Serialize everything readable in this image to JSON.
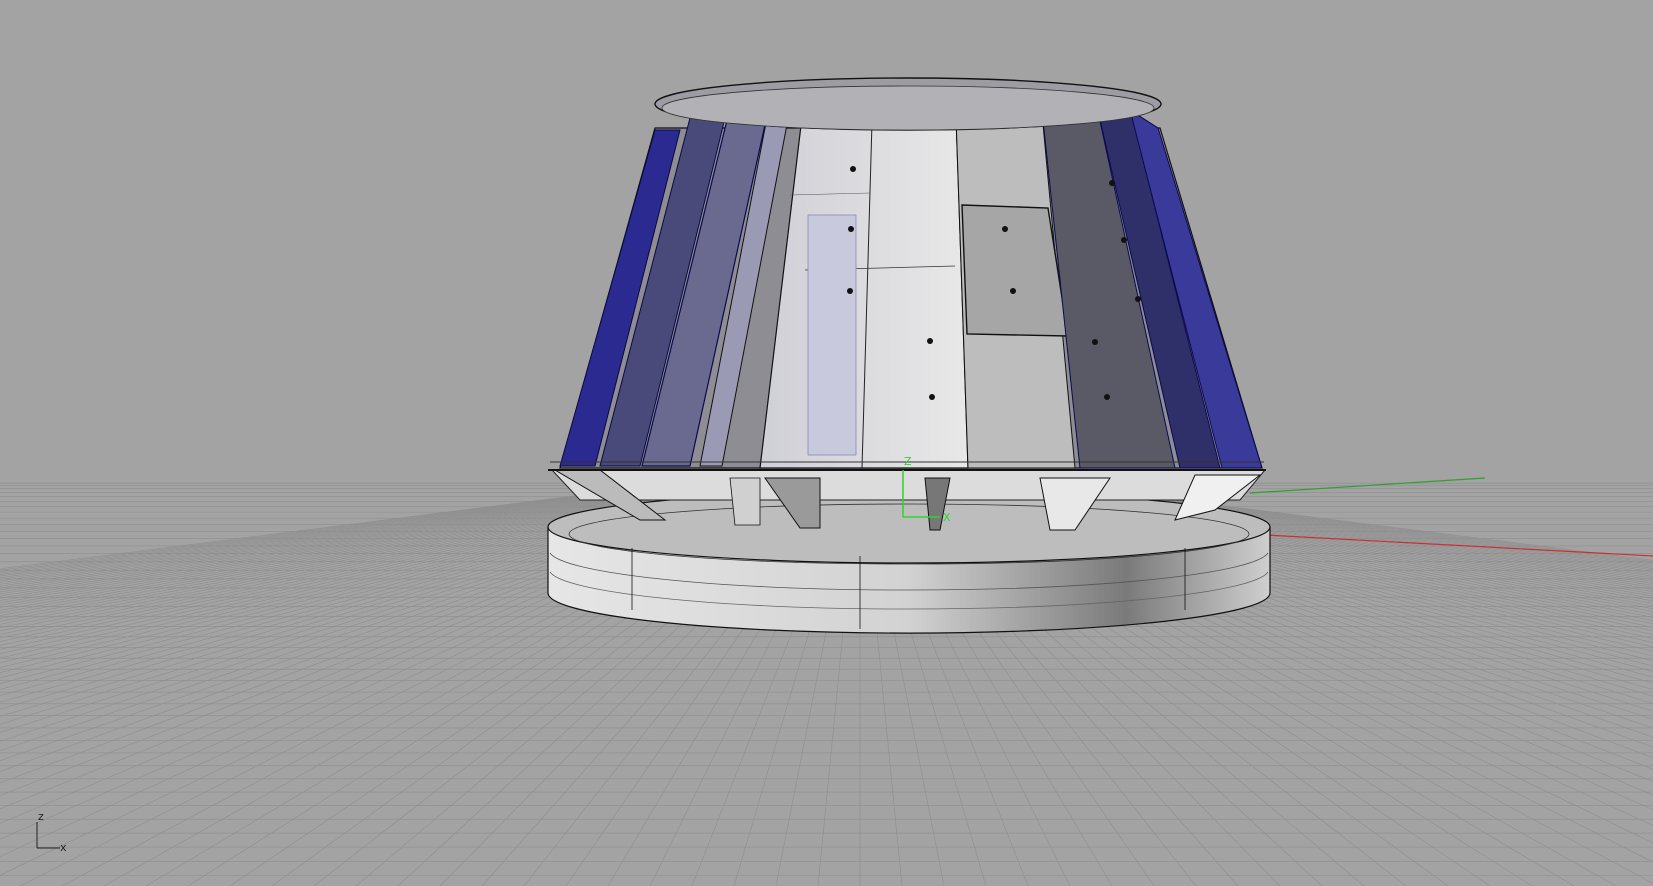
{
  "viewport": {
    "background": "#a3a3a3",
    "grid_line_color": "#8e8e8e",
    "grid_major_color": "#7f7f7f",
    "world_axes": {
      "x_color": "#c83030",
      "y_color": "#2fa02f",
      "z_color": "#2fd52f"
    }
  },
  "gumball": {
    "z_label": "Z",
    "x_label": "X"
  },
  "corner_axes": {
    "z_label": "z",
    "x_label": "x"
  },
  "colors": {
    "blue_panel": "#1a1a8c",
    "glass_light": "#d9d9d9",
    "glass_dark": "#5a5a5a",
    "base_ring": "#cfcfcf",
    "edge": "#111111"
  }
}
